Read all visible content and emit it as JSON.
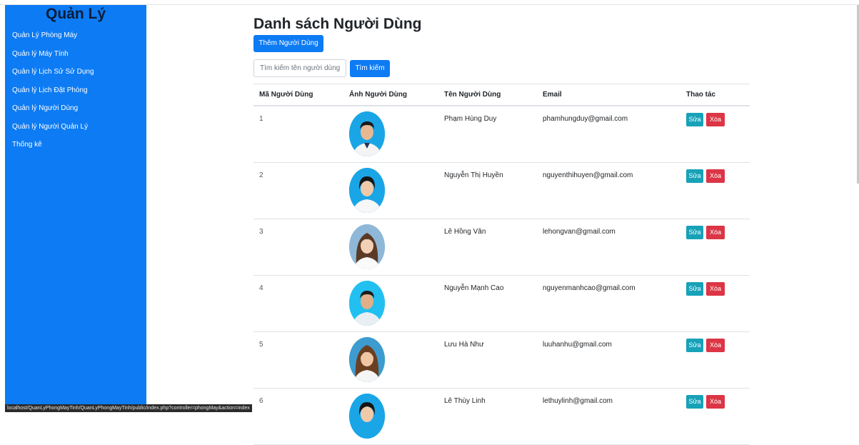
{
  "sidebar": {
    "title": "Quản Lý",
    "items": [
      {
        "label": "Quản Lý Phòng Máy"
      },
      {
        "label": "Quản lý Máy Tính"
      },
      {
        "label": "Quản lý Lịch Sử Sử Dụng"
      },
      {
        "label": "Quản lý Lịch Đặt Phòng"
      },
      {
        "label": "Quản lý Người Dùng"
      },
      {
        "label": "Quản lý Người Quản Lý"
      },
      {
        "label": "Thống kê"
      }
    ]
  },
  "status_url": "localhost/QuanLyPhongMayTinh/QuanLyPhongMayTinh/public/index.php?controller=phongMay&action=index",
  "main": {
    "title": "Danh sách Người Dùng",
    "add_button": "Thêm Người Dùng",
    "search_placeholder": "Tìm kiếm tên người dùng",
    "search_button": "Tìm kiếm",
    "columns": [
      "Mã Người Dùng",
      "Ảnh Người Dùng",
      "Tên Người Dùng",
      "Email",
      "Thao tác"
    ],
    "edit_label": "Sửa",
    "delete_label": "Xóa",
    "rows": [
      {
        "id": "1",
        "name": "Phạm Hùng Duy",
        "email": "phamhungduy@gmail.com"
      },
      {
        "id": "2",
        "name": "Nguyễn Thị Huyền",
        "email": "nguyenthihuyen@gmail.com"
      },
      {
        "id": "3",
        "name": "Lê Hồng Vân",
        "email": "lehongvan@gmail.com"
      },
      {
        "id": "4",
        "name": "Nguyễn Mạnh Cao",
        "email": "nguyenmanhcao@gmail.com"
      },
      {
        "id": "5",
        "name": "Lưu Hà Như",
        "email": "luuhanhu@gmail.com"
      },
      {
        "id": "6",
        "name": "Lê Thùy Linh",
        "email": "lethuylinh@gmail.com"
      }
    ]
  },
  "colors": {
    "primary": "#0d7bf3",
    "info": "#17a2b8",
    "danger": "#dc3545",
    "avatar_blue": "#1aa6e6"
  }
}
